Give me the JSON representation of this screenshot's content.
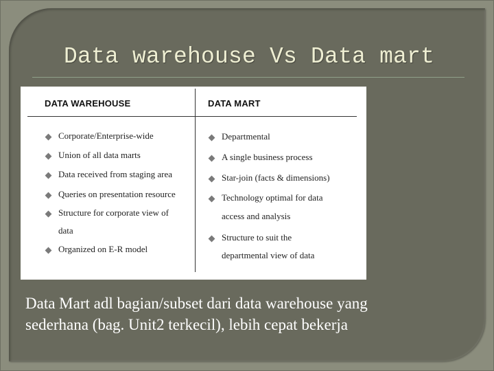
{
  "slide": {
    "title": "Data warehouse Vs Data mart",
    "table": {
      "left_header": "DATA WAREHOUSE",
      "right_header": "DATA MART",
      "left_items": [
        "Corporate/Enterprise-wide",
        "Union of all data marts",
        "Data received from staging area",
        "Queries on presentation resource",
        "Structure for corporate view of",
        "data",
        "Organized on E-R model"
      ],
      "right_items": [
        "Departmental",
        "A single business process",
        "Star-join (facts & dimensions)",
        "Technology optimal for data",
        "access and analysis",
        "Structure to suit the",
        "departmental view of data"
      ]
    },
    "caption_line1": "Data Mart adl bagian/subset dari data warehouse yang",
    "caption_line2": "sederhana (bag. Unit2 terkecil), lebih cepat bekerja",
    "colors": {
      "background": "#8b8d7d",
      "panel": "#696a5d",
      "title_text": "#eeeed2",
      "rule": "#8fa08a",
      "caption_text": "#ffffff"
    }
  }
}
